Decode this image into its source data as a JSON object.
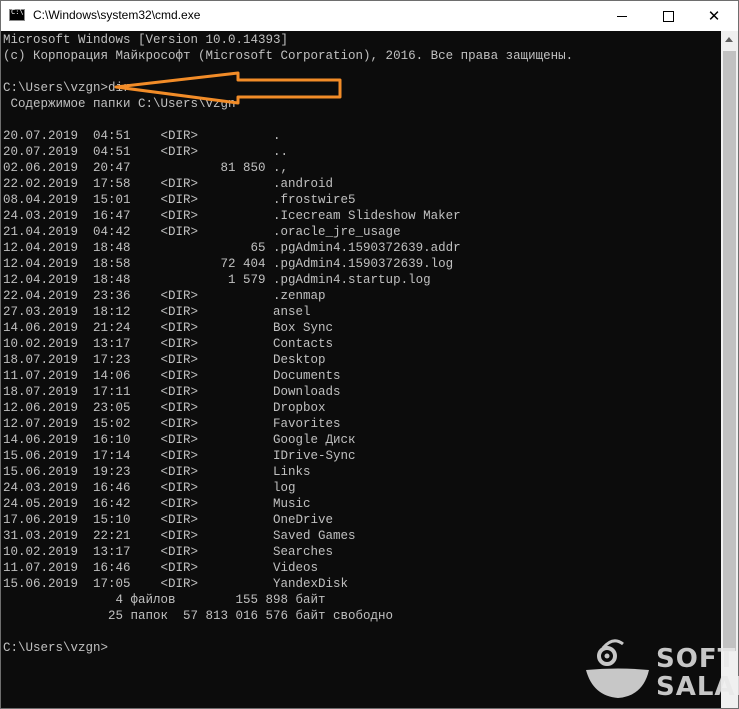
{
  "window": {
    "title": "C:\\Windows\\system32\\cmd.exe",
    "icon": "cmd-icon"
  },
  "controls": {
    "minimize": "minimize-icon",
    "maximize": "maximize-icon",
    "close_label": "✕"
  },
  "console": {
    "lines": [
      "Microsoft Windows [Version 10.0.14393]",
      "(c) Корпорация Майкрософт (Microsoft Corporation), 2016. Все права защищены.",
      "",
      "C:\\Users\\vzgn>dir",
      " Содержимое папки C:\\Users\\vzgn",
      "",
      "20.07.2019  04:51    <DIR>          .",
      "20.07.2019  04:51    <DIR>          ..",
      "02.06.2019  20:47            81 850 .,",
      "22.02.2019  17:58    <DIR>          .android",
      "08.04.2019  15:01    <DIR>          .frostwire5",
      "24.03.2019  16:47    <DIR>          .Icecream Slideshow Maker",
      "21.04.2019  04:42    <DIR>          .oracle_jre_usage",
      "12.04.2019  18:48                65 .pgAdmin4.1590372639.addr",
      "12.04.2019  18:58            72 404 .pgAdmin4.1590372639.log",
      "12.04.2019  18:48             1 579 .pgAdmin4.startup.log",
      "22.04.2019  23:36    <DIR>          .zenmap",
      "27.03.2019  18:12    <DIR>          ansel",
      "14.06.2019  21:24    <DIR>          Box Sync",
      "10.02.2019  13:17    <DIR>          Contacts",
      "18.07.2019  17:23    <DIR>          Desktop",
      "11.07.2019  14:06    <DIR>          Documents",
      "18.07.2019  17:11    <DIR>          Downloads",
      "12.06.2019  23:05    <DIR>          Dropbox",
      "12.07.2019  15:02    <DIR>          Favorites",
      "14.06.2019  16:10    <DIR>          Google Диск",
      "15.06.2019  17:14    <DIR>          IDrive-Sync",
      "15.06.2019  19:23    <DIR>          Links",
      "24.03.2019  16:46    <DIR>          log",
      "24.05.2019  16:42    <DIR>          Music",
      "17.06.2019  15:10    <DIR>          OneDrive",
      "31.03.2019  22:21    <DIR>          Saved Games",
      "10.02.2019  13:17    <DIR>          Searches",
      "11.07.2019  16:46    <DIR>          Videos",
      "15.06.2019  17:05    <DIR>          YandexDisk",
      "               4 файлов        155 898 байт",
      "              25 папок  57 813 016 576 байт свободно",
      "",
      "C:\\Users\\vzgn>"
    ]
  },
  "annotation": {
    "arrow_color": "#f28c28"
  },
  "watermark": {
    "line1": "SOFT",
    "line2": "SALAD"
  }
}
